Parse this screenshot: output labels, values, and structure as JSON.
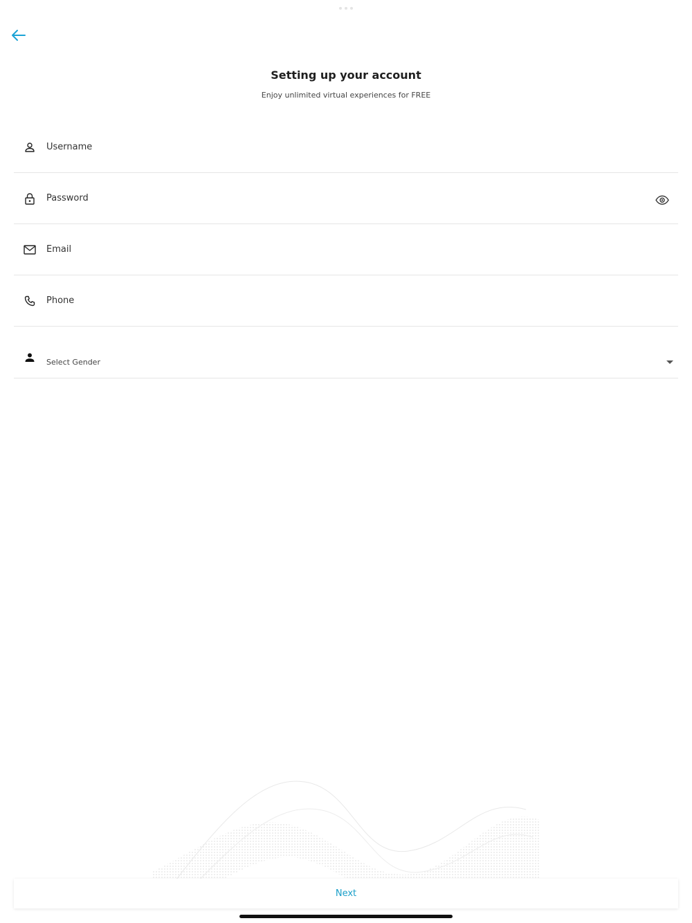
{
  "navigation": {
    "back_icon": "arrow-left-icon"
  },
  "header": {
    "title": "Setting up your account",
    "subtitle": "Enjoy unlimited virtual experiences for FREE"
  },
  "form": {
    "username": {
      "placeholder": "Username",
      "value": "",
      "icon": "user-icon"
    },
    "password": {
      "placeholder": "Password",
      "value": "",
      "icon": "lock-icon",
      "toggle_icon": "eye-icon"
    },
    "email": {
      "placeholder": "Email",
      "value": "",
      "icon": "mail-icon"
    },
    "phone": {
      "placeholder": "Phone",
      "value": "",
      "icon": "phone-icon"
    },
    "gender": {
      "label": "Select Gender",
      "icon": "person-icon",
      "dropdown_icon": "caret-down-icon"
    }
  },
  "footer": {
    "next_label": "Next"
  },
  "colors": {
    "accent": "#1a9fc9",
    "text": "#1f1f1f",
    "divider": "#e6e6e6",
    "background": "#ffffff"
  }
}
